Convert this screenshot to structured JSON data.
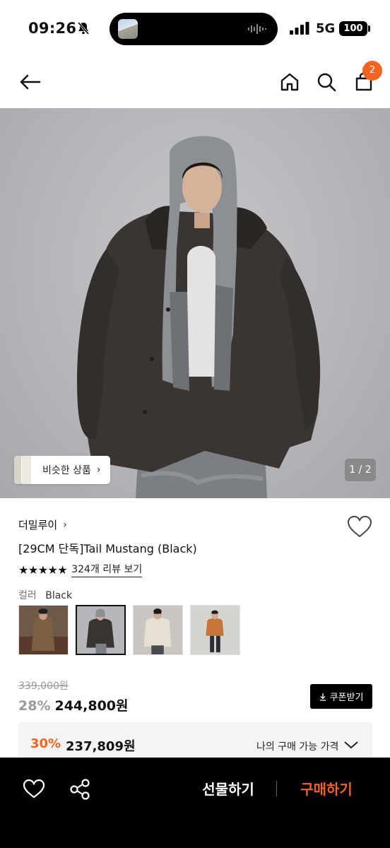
{
  "status_bar": {
    "time": "09:26",
    "network": "5G",
    "battery": "100"
  },
  "nav": {
    "cart_count": "2"
  },
  "hero": {
    "similar_label": "비슷한 상품",
    "page_indicator": "1 / 2"
  },
  "product": {
    "brand": "더밀루이",
    "title": "[29CM 단독]Tail Mustang (Black)",
    "rating_stars": "★★★★★",
    "review_link": "324개 리뷰 보기",
    "color_label": "컬러",
    "color_value": "Black",
    "swatch_count": "4",
    "selected_swatch_index": "2"
  },
  "pricing": {
    "original_price": "339,000원",
    "discount_rate": "28%",
    "sale_price": "244,800원",
    "coupon_label": "쿠폰받기",
    "my_rate": "30%",
    "my_price": "237,809원",
    "my_price_label": "나의 구매 가능 가격"
  },
  "bottom_bar": {
    "gift_label": "선물하기",
    "buy_label": "구매하기"
  },
  "colors": {
    "accent": "#f56321",
    "dark": "#000000"
  }
}
